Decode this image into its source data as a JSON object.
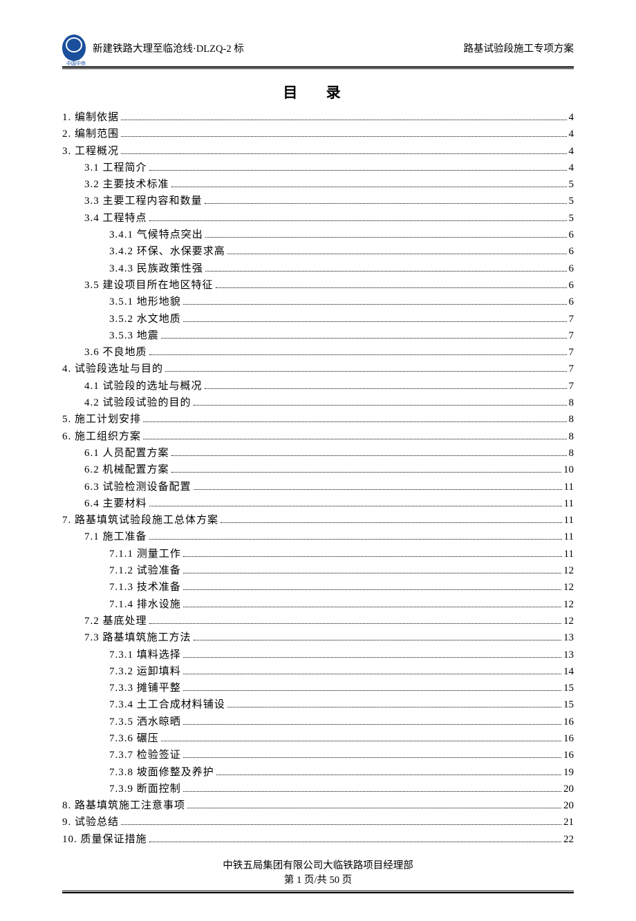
{
  "header": {
    "left": "新建铁路大理至临沧线·DLZQ-2 标",
    "right": "路基试验段施工专项方案",
    "logo_caption": "中国中铁"
  },
  "toc_title": "目 录",
  "toc": [
    {
      "label": "1. 编制依据",
      "page": "4",
      "level": 0
    },
    {
      "label": "2. 编制范围",
      "page": "4",
      "level": 0
    },
    {
      "label": "3. 工程概况",
      "page": "4",
      "level": 0
    },
    {
      "label": "3.1 工程简介",
      "page": "4",
      "level": 1
    },
    {
      "label": "3.2 主要技术标准",
      "page": "5",
      "level": 1
    },
    {
      "label": "3.3 主要工程内容和数量",
      "page": "5",
      "level": 1
    },
    {
      "label": "3.4 工程特点",
      "page": "5",
      "level": 1
    },
    {
      "label": "3.4.1 气候特点突出",
      "page": "6",
      "level": 2
    },
    {
      "label": "3.4.2 环保、水保要求高",
      "page": "6",
      "level": 2
    },
    {
      "label": "3.4.3 民族政策性强",
      "page": "6",
      "level": 2
    },
    {
      "label": "3.5 建设项目所在地区特征",
      "page": "6",
      "level": 1
    },
    {
      "label": "3.5.1 地形地貌",
      "page": "6",
      "level": 2
    },
    {
      "label": "3.5.2 水文地质",
      "page": "7",
      "level": 2
    },
    {
      "label": "3.5.3 地震",
      "page": "7",
      "level": 2
    },
    {
      "label": "3.6 不良地质",
      "page": "7",
      "level": 1
    },
    {
      "label": "4. 试验段选址与目的",
      "page": "7",
      "level": 0
    },
    {
      "label": "4.1 试验段的选址与概况",
      "page": "7",
      "level": 1
    },
    {
      "label": "4.2 试验段试验的目的",
      "page": "8",
      "level": 1
    },
    {
      "label": "5. 施工计划安排",
      "page": "8",
      "level": 0
    },
    {
      "label": "6. 施工组织方案",
      "page": "8",
      "level": 0
    },
    {
      "label": "6.1 人员配置方案",
      "page": "8",
      "level": 1
    },
    {
      "label": "6.2 机械配置方案",
      "page": "10",
      "level": 1
    },
    {
      "label": "6.3 试验检测设备配置",
      "page": "11",
      "level": 1
    },
    {
      "label": "6.4 主要材料",
      "page": "11",
      "level": 1
    },
    {
      "label": "7. 路基填筑试验段施工总体方案",
      "page": "11",
      "level": 0
    },
    {
      "label": "7.1 施工准备",
      "page": "11",
      "level": 1
    },
    {
      "label": "7.1.1 测量工作",
      "page": "11",
      "level": 2
    },
    {
      "label": "7.1.2 试验准备",
      "page": "12",
      "level": 2
    },
    {
      "label": "7.1.3 技术准备",
      "page": "12",
      "level": 2
    },
    {
      "label": "7.1.4 排水设施",
      "page": "12",
      "level": 2
    },
    {
      "label": "7.2 基底处理",
      "page": "12",
      "level": 1
    },
    {
      "label": "7.3 路基填筑施工方法",
      "page": "13",
      "level": 1
    },
    {
      "label": "7.3.1 填料选择",
      "page": "13",
      "level": 2
    },
    {
      "label": "7.3.2 运卸填料",
      "page": "14",
      "level": 2
    },
    {
      "label": "7.3.3 摊铺平整",
      "page": "15",
      "level": 2
    },
    {
      "label": "7.3.4 土工合成材料铺设",
      "page": "15",
      "level": 2
    },
    {
      "label": "7.3.5 洒水晾晒",
      "page": "16",
      "level": 2
    },
    {
      "label": "7.3.6 碾压",
      "page": "16",
      "level": 2
    },
    {
      "label": "7.3.7 检验签证",
      "page": "16",
      "level": 2
    },
    {
      "label": "7.3.8 坡面修整及养护",
      "page": "19",
      "level": 2
    },
    {
      "label": "7.3.9 断面控制",
      "page": "20",
      "level": 2
    },
    {
      "label": "8. 路基填筑施工注意事项",
      "page": "20",
      "level": 0
    },
    {
      "label": "9. 试验总结",
      "page": "21",
      "level": 0
    },
    {
      "label": "10. 质量保证措施",
      "page": "22",
      "level": 0
    }
  ],
  "footer": {
    "org": "中铁五局集团有限公司大临铁路项目经理部",
    "page_info": "第 1 页/共 50 页"
  }
}
